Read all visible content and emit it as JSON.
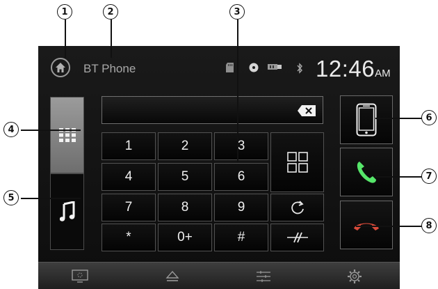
{
  "callouts": [
    "1",
    "2",
    "3",
    "4",
    "5",
    "6",
    "7",
    "8"
  ],
  "header": {
    "title": "BT Phone",
    "clock_time": "12:46",
    "clock_ampm": "AM",
    "icons": [
      "home-icon",
      "sd-card-icon",
      "disc-icon",
      "usb-icon",
      "bluetooth-icon"
    ]
  },
  "sidebar": {
    "tabs": [
      {
        "name": "keypad",
        "icon": "keypad-icon",
        "active": true
      },
      {
        "name": "music",
        "icon": "music-note-icon",
        "active": false
      }
    ]
  },
  "dialer": {
    "number_value": "",
    "backspace_icon": "backspace-icon",
    "keys": [
      "1",
      "2",
      "3",
      "4",
      "5",
      "6",
      "7",
      "8",
      "9",
      "*",
      "0+",
      "#"
    ],
    "side_keys": [
      "contacts-grid-icon",
      "redial-icon",
      "disconnect-link-icon"
    ]
  },
  "actions": {
    "icons": [
      "phone-device-icon",
      "call-accept-icon",
      "call-end-icon"
    ],
    "accept_color": "#56e66a",
    "end_color": "#d84a3a"
  },
  "bottom_bar": {
    "icons": [
      "display-icon",
      "eject-icon",
      "equalizer-icon",
      "settings-icon"
    ]
  }
}
